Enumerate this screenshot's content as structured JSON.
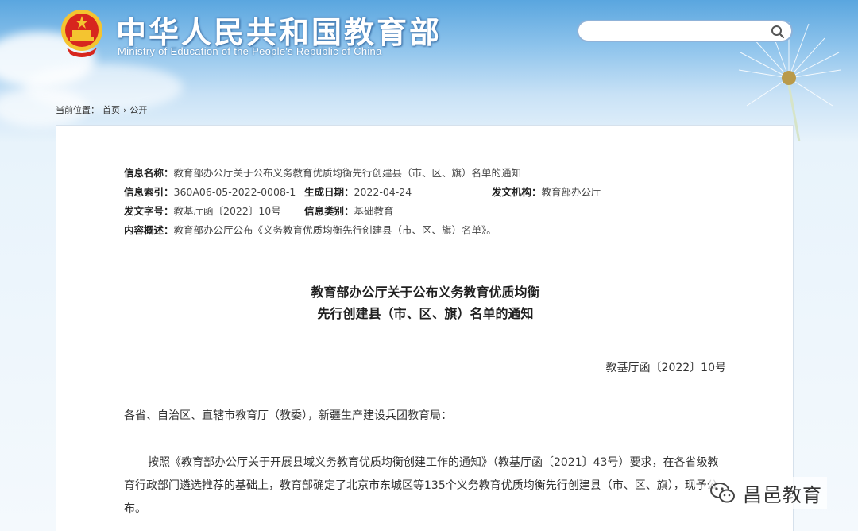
{
  "header": {
    "title_cn": "中华人民共和国教育部",
    "title_en": "Ministry of Education of the People's Republic of China",
    "emblem_icon": "national-emblem-icon"
  },
  "search": {
    "placeholder": "",
    "icon": "search-icon"
  },
  "breadcrumb": {
    "prefix": "当前位置：",
    "items": [
      "首页",
      "公开"
    ],
    "separator": "›"
  },
  "meta": {
    "name_label": "信息名称：",
    "name_value": "教育部办公厅关于公布义务教育优质均衡先行创建县（市、区、旗）名单的通知",
    "index_label": "信息索引：",
    "index_value": "360A06-05-2022-0008-1",
    "date_label": "生成日期：",
    "date_value": "2022-04-24",
    "issuer_label": "发文机构：",
    "issuer_value": "教育部办公厅",
    "docno_label": "发文字号：",
    "docno_value": "教基厅函〔2022〕10号",
    "category_label": "信息类别：",
    "category_value": "基础教育",
    "summary_label": "内容概述：",
    "summary_value": "教育部办公厅公布《义务教育优质均衡先行创建县（市、区、旗）名单》。"
  },
  "document": {
    "title_line1": "教育部办公厅关于公布义务教育优质均衡",
    "title_line2": "先行创建县（市、区、旗）名单的通知",
    "number": "教基厅函〔2022〕10号",
    "salutation": "各省、自治区、直辖市教育厅（教委），新疆生产建设兵团教育局：",
    "paragraph": "按照《教育部办公厅关于开展县域义务教育优质均衡创建工作的通知》（教基厅函〔2021〕43号）要求，在各省级教育行政部门遴选推荐的基础上，教育部确定了北京市东城区等135个义务教育优质均衡先行创建县（市、区、旗），现予公布。"
  },
  "watermark": {
    "text": "昌邑教育",
    "icon": "wechat-icon"
  },
  "colors": {
    "sky_top": "#5aa6df",
    "sky_bottom": "#f4f9fd",
    "emblem_red": "#d7261e",
    "emblem_gold": "#f4c430"
  }
}
